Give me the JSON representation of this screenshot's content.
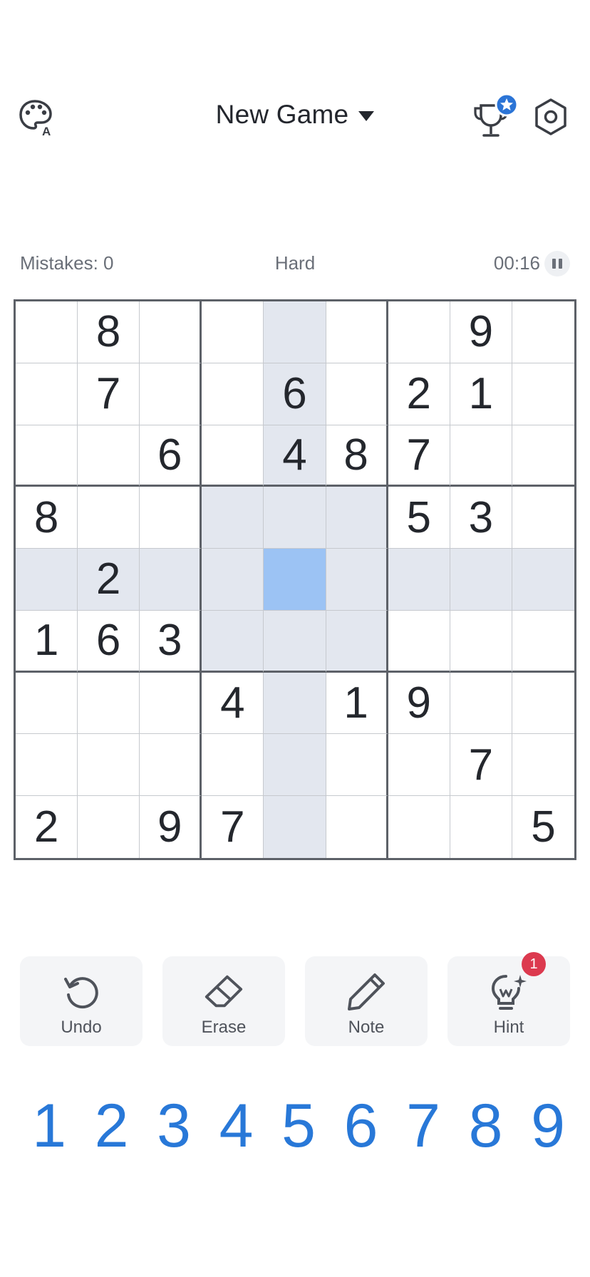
{
  "header": {
    "title": "New Game",
    "theme_icon": "palette-icon",
    "trophy_icon": "trophy-icon",
    "settings_icon": "hexagon-settings-icon"
  },
  "status": {
    "mistakes": "Mistakes: 0",
    "difficulty": "Hard",
    "timer": "00:16"
  },
  "board": {
    "rows": [
      [
        "",
        "8",
        "",
        "",
        "",
        "",
        "",
        "9",
        ""
      ],
      [
        "",
        "7",
        "",
        "",
        "6",
        "",
        "2",
        "1",
        ""
      ],
      [
        "",
        "",
        "6",
        "",
        "4",
        "8",
        "7",
        "",
        ""
      ],
      [
        "8",
        "",
        "",
        "",
        "",
        "",
        "5",
        "3",
        ""
      ],
      [
        "",
        "2",
        "",
        "",
        "",
        "",
        "",
        "",
        ""
      ],
      [
        "1",
        "6",
        "3",
        "",
        "",
        "",
        "",
        "",
        ""
      ],
      [
        "",
        "",
        "",
        "4",
        "",
        "1",
        "9",
        "",
        ""
      ],
      [
        "",
        "",
        "",
        "",
        "",
        "",
        "",
        "7",
        ""
      ],
      [
        "2",
        "",
        "9",
        "7",
        "",
        "",
        "",
        "",
        "5"
      ]
    ],
    "selected": {
      "row": 5,
      "col": 5
    }
  },
  "tools": [
    {
      "label": "Undo",
      "icon": "undo-icon"
    },
    {
      "label": "Erase",
      "icon": "eraser-icon"
    },
    {
      "label": "Note",
      "icon": "pencil-icon"
    },
    {
      "label": "Hint",
      "icon": "lightbulb-icon",
      "badge": "1"
    }
  ],
  "numpad": [
    "1",
    "2",
    "3",
    "4",
    "5",
    "6",
    "7",
    "8",
    "9"
  ],
  "colors": {
    "accent": "#2878d8",
    "selected_cell": "#9cc3f4",
    "highlight": "#e3e7ef",
    "badge": "#dc3a4f"
  }
}
